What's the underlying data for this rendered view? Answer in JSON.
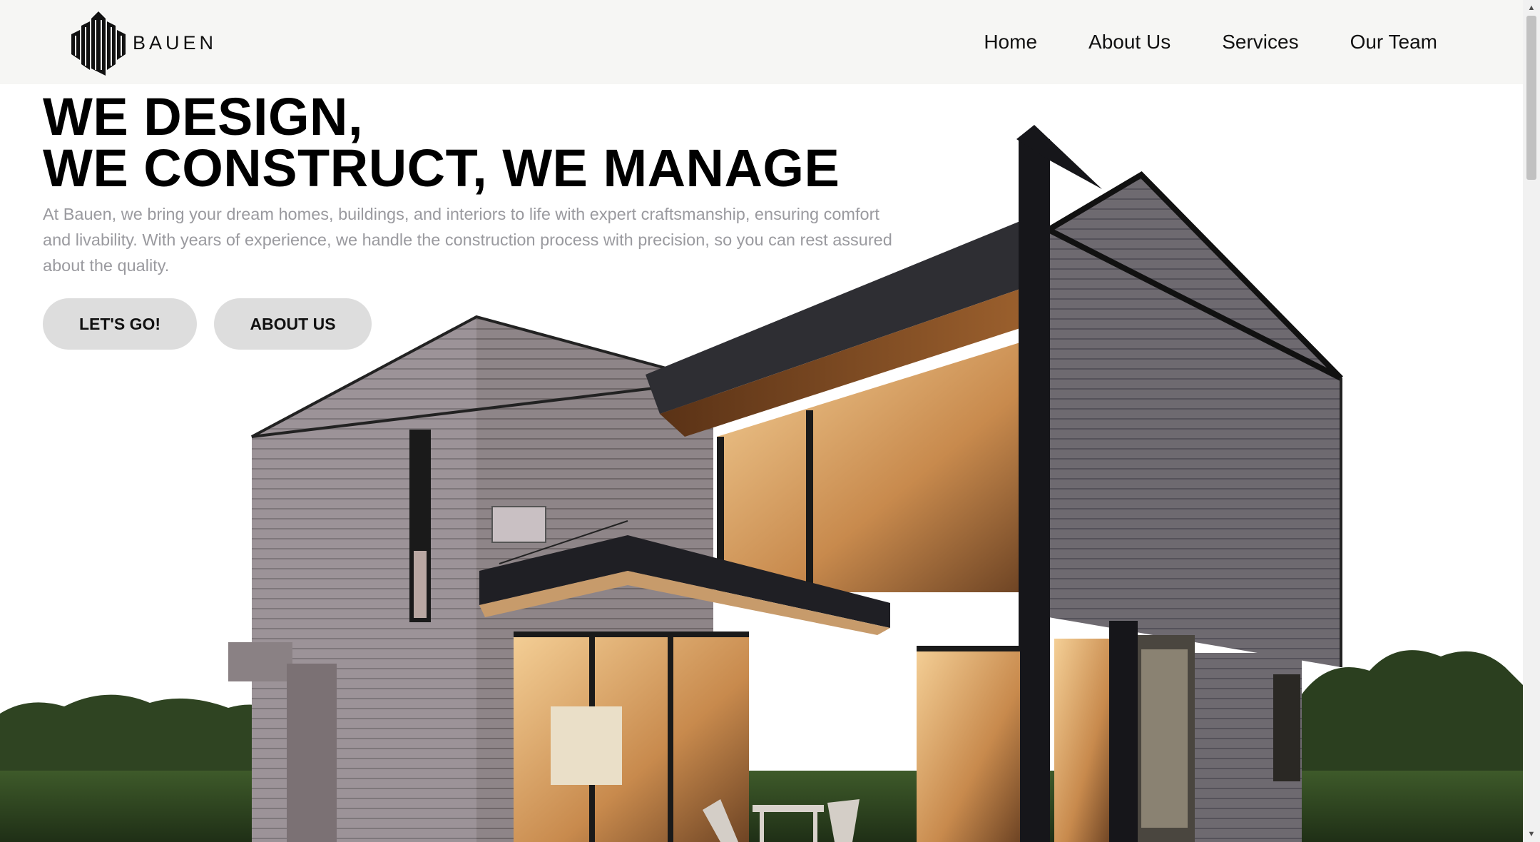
{
  "brand": {
    "name": "BAUEN",
    "logo_icon": "building-logo-icon"
  },
  "nav": {
    "items": [
      {
        "label": "Home"
      },
      {
        "label": "About Us"
      },
      {
        "label": "Services"
      },
      {
        "label": "Our Team"
      }
    ]
  },
  "hero": {
    "title_line1": "WE DESIGN,",
    "title_line2": "WE CONSTRUCT, WE MANAGE",
    "description": "At Bauen, we bring your dream homes, buildings, and interiors to life with expert craftsmanship, ensuring comfort and livability. With years of experience, we handle the construction process with precision, so you can rest assured about the quality.",
    "primary_button": "LET'S GO!",
    "secondary_button": "ABOUT US",
    "image": "modern-house-image"
  },
  "colors": {
    "header_bg": "#f6f6f4",
    "text": "#000000",
    "muted_text": "#9a9a9f",
    "button_bg": "#dddddd"
  }
}
